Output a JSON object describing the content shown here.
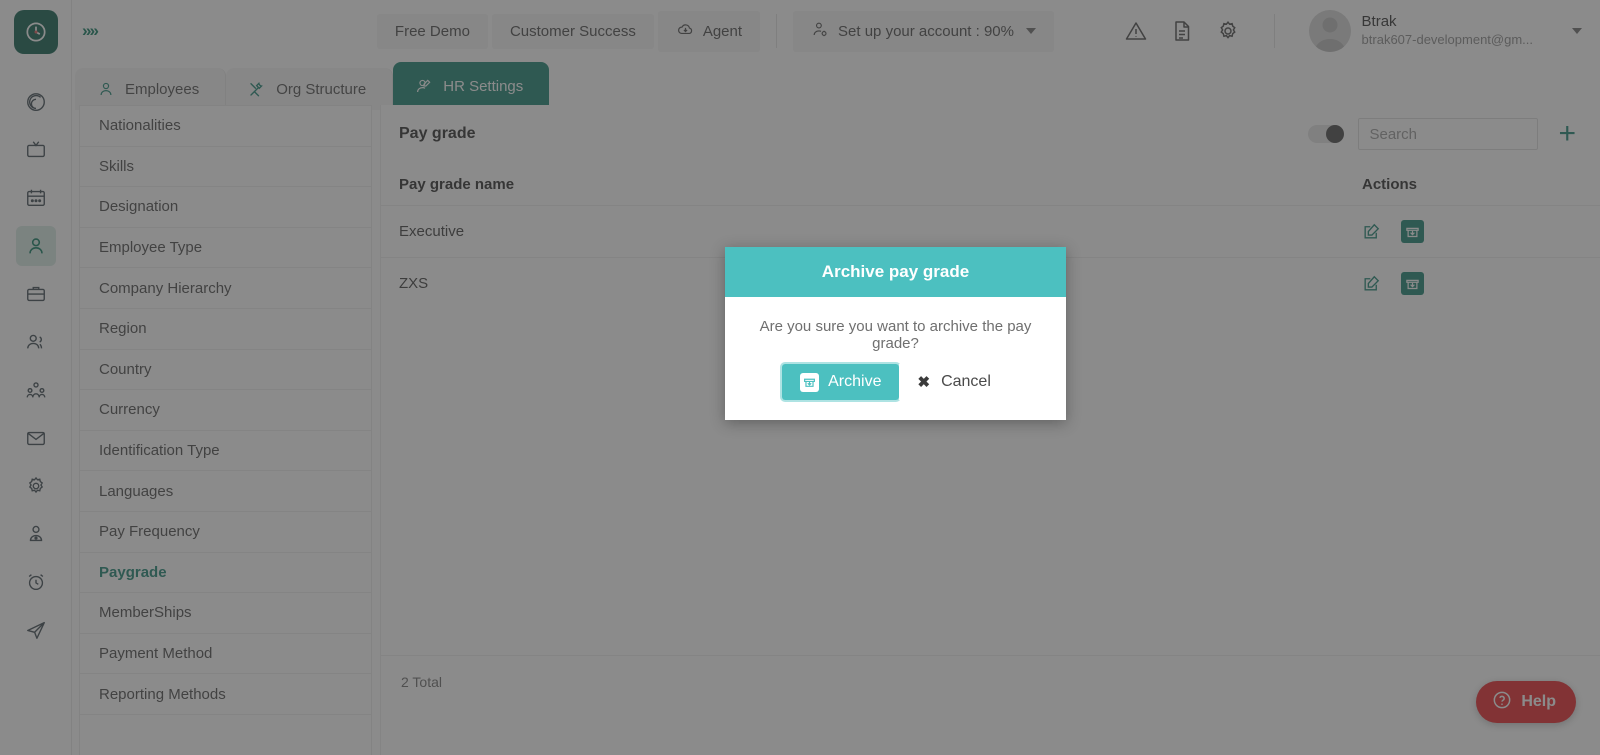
{
  "brand": {
    "logo_icon": "clock-gauge-logo-icon",
    "logo_color": "#0d5c4d",
    "accent": "#1b8370",
    "modal_accent": "#4cc0c0",
    "help_color": "#e8252a"
  },
  "header": {
    "expand_icon": "chevrons-right-icon",
    "buttons": [
      {
        "label": "Free Demo",
        "icon": null
      },
      {
        "label": "Customer Success",
        "icon": null
      },
      {
        "label": "Agent",
        "icon": "cloud-download-icon"
      }
    ],
    "account_setup": {
      "label": "Set up your account : 90%",
      "icon": "user-gear-icon",
      "caret": "chevron-down-icon"
    },
    "icons": [
      {
        "name": "warning-triangle-icon"
      },
      {
        "name": "document-icon"
      },
      {
        "name": "gear-icon"
      }
    ],
    "user": {
      "name": "Btrak",
      "email": "btrak607-development@gm...",
      "avatar_icon": "user-avatar-icon",
      "caret": "chevron-down-icon"
    }
  },
  "rail": {
    "items": [
      {
        "name": "target-icon",
        "active": false
      },
      {
        "name": "tv-icon",
        "active": false
      },
      {
        "name": "calendar-icon",
        "active": false
      },
      {
        "name": "user-icon",
        "active": true
      },
      {
        "name": "briefcase-icon",
        "active": false
      },
      {
        "name": "users-icon",
        "active": false
      },
      {
        "name": "org-group-icon",
        "active": false
      },
      {
        "name": "mail-icon",
        "active": false
      },
      {
        "name": "gear-icon",
        "active": false
      },
      {
        "name": "user-badge-icon",
        "active": false
      },
      {
        "name": "alarm-clock-icon",
        "active": false
      },
      {
        "name": "send-icon",
        "active": false
      }
    ]
  },
  "tabs": [
    {
      "label": "Employees",
      "icon": "user-icon",
      "active": false
    },
    {
      "label": "Org Structure",
      "icon": "tools-icon",
      "active": false
    },
    {
      "label": "HR Settings",
      "icon": "user-settings-icon",
      "active": true
    }
  ],
  "settings_menu": {
    "items": [
      {
        "label": "Nationalities",
        "active": false
      },
      {
        "label": "Skills",
        "active": false
      },
      {
        "label": "Designation",
        "active": false
      },
      {
        "label": "Employee Type",
        "active": false
      },
      {
        "label": "Company Hierarchy",
        "active": false
      },
      {
        "label": "Region",
        "active": false
      },
      {
        "label": "Country",
        "active": false
      },
      {
        "label": "Currency",
        "active": false
      },
      {
        "label": "Identification Type",
        "active": false
      },
      {
        "label": "Languages",
        "active": false
      },
      {
        "label": "Pay Frequency",
        "active": false
      },
      {
        "label": "Paygrade",
        "active": true
      },
      {
        "label": "MemberShips",
        "active": false
      },
      {
        "label": "Payment Method",
        "active": false
      },
      {
        "label": "Reporting Methods",
        "active": false
      }
    ]
  },
  "content": {
    "title": "Pay grade",
    "toggle_state": "off",
    "search": {
      "placeholder": "Search",
      "value": ""
    },
    "add_label": "+",
    "columns": {
      "name": "Pay grade name",
      "actions": "Actions"
    },
    "rows": [
      {
        "name": "Executive",
        "edit_icon": "edit-pencil-icon",
        "archive_icon": "archive-box-icon"
      },
      {
        "name": "ZXS",
        "edit_icon": "edit-pencil-icon",
        "archive_icon": "archive-box-icon"
      }
    ],
    "total_label": "2 Total"
  },
  "help": {
    "label": "Help",
    "icon": "question-circle-icon"
  },
  "modal": {
    "title": "Archive pay grade",
    "message": "Are you sure you want to archive the pay grade?",
    "confirm": {
      "label": "Archive",
      "icon": "archive-box-icon"
    },
    "cancel": {
      "label": "Cancel",
      "icon": "close-x-icon"
    }
  }
}
